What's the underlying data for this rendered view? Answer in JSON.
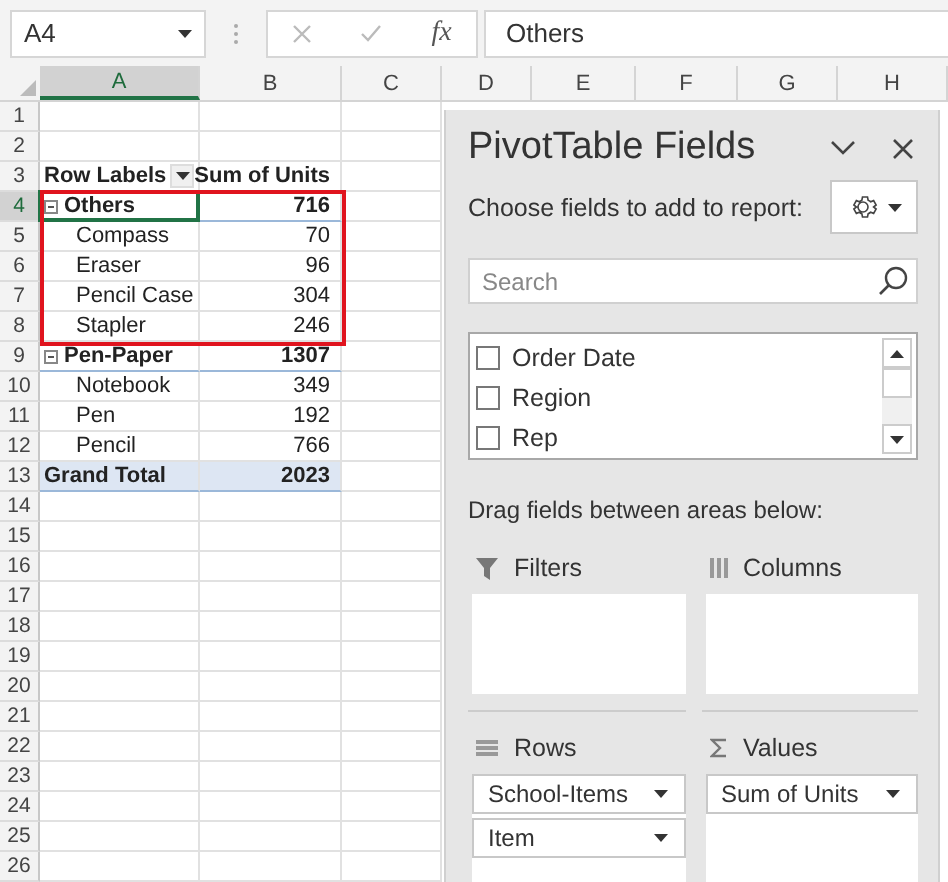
{
  "name_box": "A4",
  "formula_bar": {
    "function_label": "fx",
    "formula": "Others"
  },
  "columns": [
    {
      "label": "A",
      "selected": true
    },
    {
      "label": "B",
      "selected": false
    },
    {
      "label": "C",
      "selected": false
    },
    {
      "label": "D",
      "selected": false
    },
    {
      "label": "E",
      "selected": false
    },
    {
      "label": "F",
      "selected": false
    },
    {
      "label": "G",
      "selected": false
    },
    {
      "label": "H",
      "selected": false
    }
  ],
  "rows": [
    {
      "number": "1",
      "kind": "empty",
      "selected": false
    },
    {
      "number": "2",
      "kind": "empty",
      "selected": false
    },
    {
      "number": "3",
      "kind": "header",
      "selected": false,
      "label": "Row Labels",
      "value": "Sum of Units"
    },
    {
      "number": "4",
      "kind": "group",
      "selected": true,
      "outlined": true,
      "expanded": true,
      "label": "Others",
      "value": "716"
    },
    {
      "number": "5",
      "kind": "item",
      "selected": false,
      "outlined": true,
      "label": "Compass",
      "value": "70"
    },
    {
      "number": "6",
      "kind": "item",
      "selected": false,
      "outlined": true,
      "label": "Eraser",
      "value": "96"
    },
    {
      "number": "7",
      "kind": "item",
      "selected": false,
      "outlined": true,
      "label": "Pencil Case",
      "value": "304"
    },
    {
      "number": "8",
      "kind": "item",
      "selected": false,
      "outlined": true,
      "label": "Stapler",
      "value": "246"
    },
    {
      "number": "9",
      "kind": "group",
      "selected": false,
      "expanded": true,
      "label": "Pen-Paper",
      "value": "1307"
    },
    {
      "number": "10",
      "kind": "item",
      "selected": false,
      "label": "Notebook",
      "value": "349"
    },
    {
      "number": "11",
      "kind": "item",
      "selected": false,
      "label": "Pen",
      "value": "192"
    },
    {
      "number": "12",
      "kind": "item",
      "selected": false,
      "label": "Pencil",
      "value": "766"
    },
    {
      "number": "13",
      "kind": "total",
      "selected": false,
      "label": "Grand Total",
      "value": "2023"
    },
    {
      "number": "14",
      "kind": "empty",
      "selected": false
    },
    {
      "number": "15",
      "kind": "empty",
      "selected": false
    },
    {
      "number": "16",
      "kind": "empty",
      "selected": false
    },
    {
      "number": "17",
      "kind": "empty",
      "selected": false
    },
    {
      "number": "18",
      "kind": "empty",
      "selected": false
    },
    {
      "number": "19",
      "kind": "empty",
      "selected": false
    },
    {
      "number": "20",
      "kind": "empty",
      "selected": false
    },
    {
      "number": "21",
      "kind": "empty",
      "selected": false
    },
    {
      "number": "22",
      "kind": "empty",
      "selected": false
    },
    {
      "number": "23",
      "kind": "empty",
      "selected": false
    },
    {
      "number": "24",
      "kind": "empty",
      "selected": false
    },
    {
      "number": "25",
      "kind": "empty",
      "selected": false
    },
    {
      "number": "26",
      "kind": "empty",
      "selected": false
    }
  ],
  "pivot_panel": {
    "title": "PivotTable Fields",
    "prompt": "Choose fields to add to report:",
    "search": {
      "placeholder": "Search"
    },
    "fields": [
      {
        "label": "Order Date",
        "checked": false
      },
      {
        "label": "Region",
        "checked": false
      },
      {
        "label": "Rep",
        "checked": false
      }
    ],
    "areas_prompt": "Drag fields between areas below:",
    "areas": [
      {
        "kind": "filters",
        "title": "Filters"
      },
      {
        "kind": "columns",
        "title": "Columns"
      },
      {
        "kind": "rows",
        "title": "Rows",
        "items": [
          "School-Items",
          "Item"
        ]
      },
      {
        "kind": "values",
        "title": "Values",
        "items": [
          "Sum of Units"
        ]
      }
    ]
  }
}
